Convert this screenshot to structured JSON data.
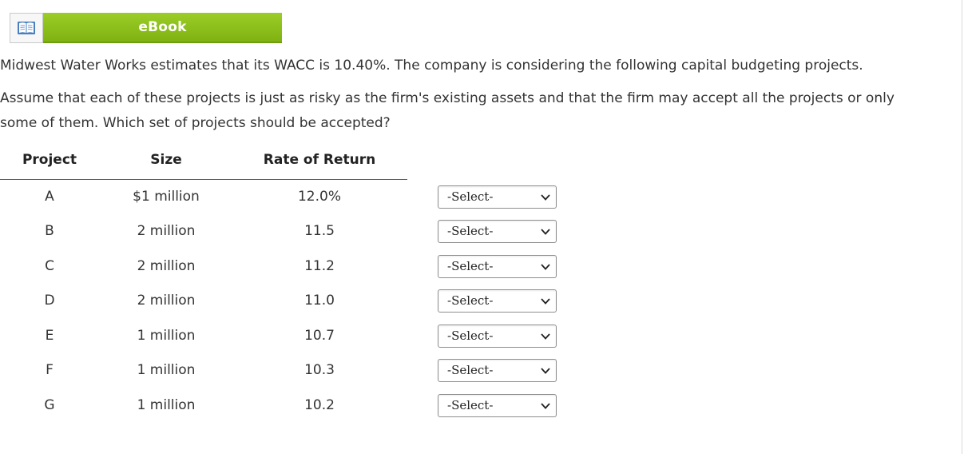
{
  "ebook": {
    "label": "eBook",
    "icon": "open-book-icon"
  },
  "question": {
    "line1": "Midwest Water Works estimates that its WACC is 10.40%. The company is considering the following capital budgeting projects.",
    "line2": "Assume that each of these projects is just as risky as the firm's existing assets and that the firm may accept all the projects or only",
    "line3": "some of them. Which set of projects should be accepted?"
  },
  "table": {
    "headers": {
      "project": "Project",
      "size": "Size",
      "rate": "Rate of Return"
    },
    "rows": [
      {
        "project": "A",
        "size": "$1 million",
        "rate": "12.0%",
        "select": "-Select-"
      },
      {
        "project": "B",
        "size": "2 million",
        "rate": "11.5",
        "select": "-Select-"
      },
      {
        "project": "C",
        "size": "2 million",
        "rate": "11.2",
        "select": "-Select-"
      },
      {
        "project": "D",
        "size": "2 million",
        "rate": "11.0",
        "select": "-Select-"
      },
      {
        "project": "E",
        "size": "1 million",
        "rate": "10.7",
        "select": "-Select-"
      },
      {
        "project": "F",
        "size": "1 million",
        "rate": "10.3",
        "select": "-Select-"
      },
      {
        "project": "G",
        "size": "1 million",
        "rate": "10.2",
        "select": "-Select-"
      }
    ]
  },
  "colors": {
    "ebook_green": "#8cc11c",
    "text": "#333333"
  }
}
